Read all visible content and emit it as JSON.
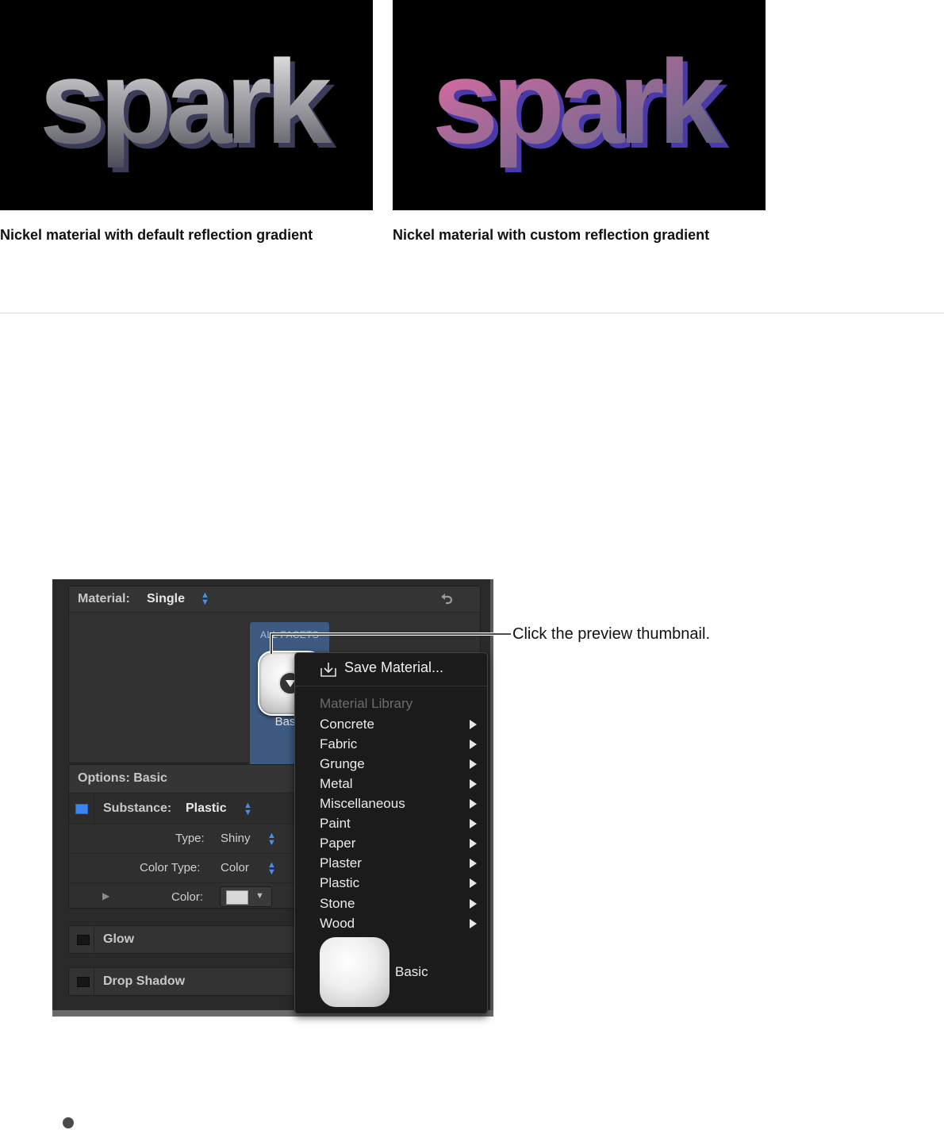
{
  "previews": {
    "left": {
      "word": "spark",
      "caption": "Nickel material with default reflection gradient"
    },
    "right": {
      "word": "spark",
      "caption": "Nickel material with custom reflection gradient"
    }
  },
  "inspector": {
    "material_label": "Material:",
    "material_value": "Single",
    "facet_label": "ALL FACETS",
    "facet_name": "Basic",
    "options_label": "Options: Basic",
    "substance_label": "Substance:",
    "substance_value": "Plastic",
    "type_label": "Type:",
    "type_value": "Shiny",
    "color_type_label": "Color Type:",
    "color_type_value": "Color",
    "color_label": "Color:",
    "glow_label": "Glow",
    "drop_shadow_label": "Drop Shadow",
    "accent_color": "#3a83f0"
  },
  "menu": {
    "save_label": "Save Material...",
    "library_header": "Material Library",
    "items": [
      "Concrete",
      "Fabric",
      "Grunge",
      "Metal",
      "Miscellaneous",
      "Paint",
      "Paper",
      "Plaster",
      "Plastic",
      "Stone",
      "Wood"
    ],
    "thumbnail_label": "Basic"
  },
  "callout": {
    "text": "Click the preview thumbnail."
  },
  "icons": [
    "undo-icon",
    "save-material-icon",
    "submenu-arrow-icon",
    "disclosure-triangle-icon",
    "stepper-icon",
    "preview-menu-button-icon",
    "bullet-icon"
  ]
}
